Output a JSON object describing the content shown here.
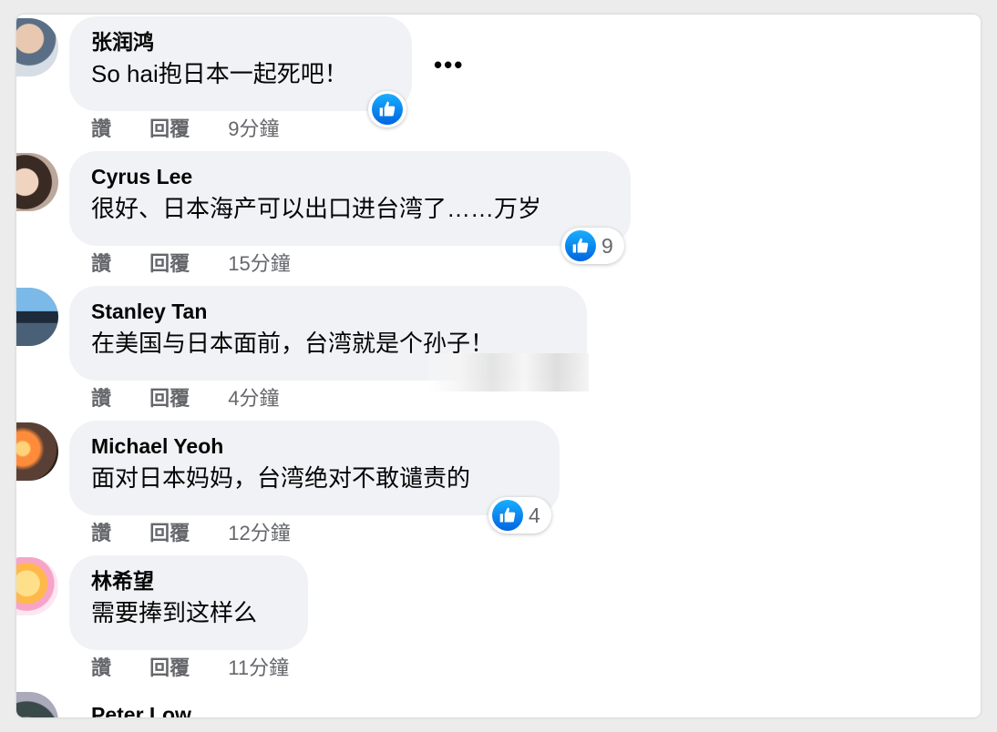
{
  "comments": [
    {
      "name": "张润鸿",
      "text": "So hai抱日本一起死吧！",
      "like": "讚",
      "reply": "回覆",
      "time": "9分鐘",
      "reaction_count": ""
    },
    {
      "name": "Cyrus Lee",
      "text": "很好、日本海产可以出口进台湾了……万岁",
      "like": "讚",
      "reply": "回覆",
      "time": "15分鐘",
      "reaction_count": "9"
    },
    {
      "name": "Stanley Tan",
      "text": "在美国与日本面前，台湾就是个孙子！",
      "like": "讚",
      "reply": "回覆",
      "time": "4分鐘",
      "reaction_count": ""
    },
    {
      "name": "Michael Yeoh",
      "text": "面对日本妈妈，台湾绝对不敢谴责的",
      "like": "讚",
      "reply": "回覆",
      "time": "12分鐘",
      "reaction_count": "4"
    },
    {
      "name": "林希望",
      "text": "需要捧到这样么",
      "like": "讚",
      "reply": "回覆",
      "time": "11分鐘",
      "reaction_count": ""
    }
  ],
  "partial_next_name": "Peter Low",
  "more_menu": "•••",
  "icons": {
    "reaction": "like-thumb-icon",
    "menu": "more-options-icon"
  },
  "colors": {
    "bubble": "#f0f2f5",
    "like_blue": "#0866ff",
    "meta_gray": "#65676b"
  }
}
